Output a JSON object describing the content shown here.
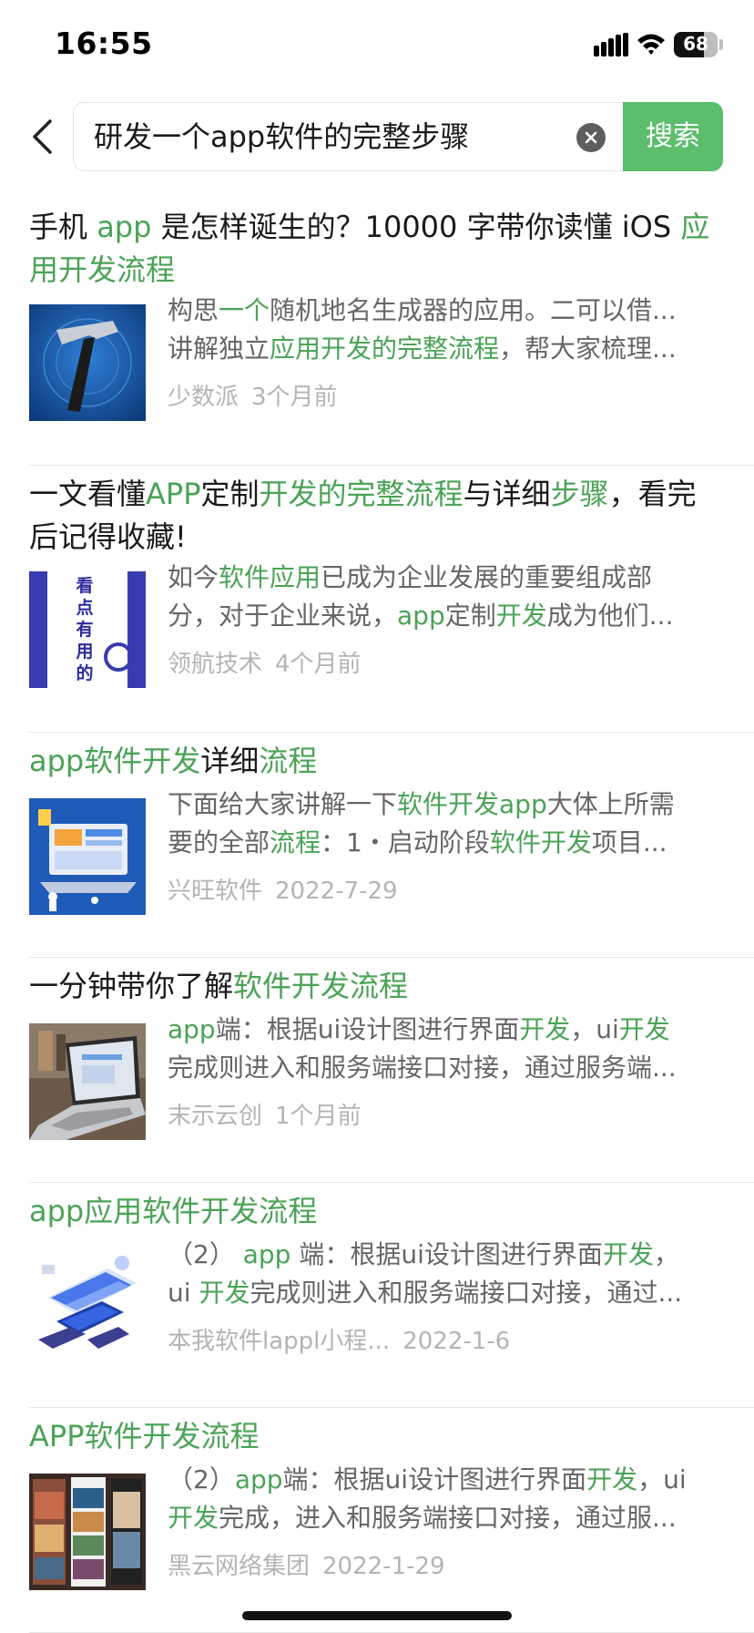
{
  "status_bar": {
    "time": "16:55",
    "battery": "68",
    "battery_level": 0.68
  },
  "search": {
    "query": "研发一个app软件的完整步骤",
    "button_label": "搜索"
  },
  "colors": {
    "accent_green": "#5cbd6c",
    "highlight_green": "#4aa356",
    "meta_gray": "#b4b4b4"
  },
  "results": [
    {
      "title": [
        {
          "t": "手机 ",
          "h": false
        },
        {
          "t": "app",
          "h": true
        },
        {
          "t": " 是怎样诞生的？10000 字带你读懂 iOS ",
          "h": false
        },
        {
          "t": "应用开发流程",
          "h": true
        }
      ],
      "snippet": [
        [
          {
            "t": "构思",
            "h": false
          },
          {
            "t": "一个",
            "h": true
          },
          {
            "t": "随机地名生成器的应用。二可以借...",
            "h": false
          }
        ],
        [
          {
            "t": "讲解独立",
            "h": false
          },
          {
            "t": "应用开发的完整流程",
            "h": true
          },
          {
            "t": "，帮大家梳理...",
            "h": false
          }
        ]
      ],
      "source": "少数派",
      "date": "3个月前",
      "thumb": "hammer-icon"
    },
    {
      "title": [
        {
          "t": "一文看懂",
          "h": false
        },
        {
          "t": "APP",
          "h": true
        },
        {
          "t": "定制",
          "h": false
        },
        {
          "t": "开发的完整流程",
          "h": true
        },
        {
          "t": "与详细",
          "h": false
        },
        {
          "t": "步骤",
          "h": true
        },
        {
          "t": "，看完后记得收藏!",
          "h": false
        }
      ],
      "snippet": [
        [
          {
            "t": "如今",
            "h": false
          },
          {
            "t": "软件应用",
            "h": true
          },
          {
            "t": "已成为企业发展的重要组成部",
            "h": false
          }
        ],
        [
          {
            "t": "分，对于企业来说，",
            "h": false
          },
          {
            "t": "app",
            "h": true
          },
          {
            "t": "定制",
            "h": false
          },
          {
            "t": "开发",
            "h": true
          },
          {
            "t": "成为他们...",
            "h": false
          }
        ]
      ],
      "source": "领航技术",
      "date": "4个月前",
      "thumb": "poster-image",
      "thumb_text": [
        "看",
        "点",
        "有",
        "用",
        "的"
      ]
    },
    {
      "title": [
        {
          "t": "app软件开发",
          "h": true
        },
        {
          "t": "详细",
          "h": false
        },
        {
          "t": "流程",
          "h": true
        }
      ],
      "snippet": [
        [
          {
            "t": "下面给大家讲解一下",
            "h": false
          },
          {
            "t": "软件开发app",
            "h": true
          },
          {
            "t": "大体上所需",
            "h": false
          }
        ],
        [
          {
            "t": "要的全部",
            "h": false
          },
          {
            "t": "流程",
            "h": true
          },
          {
            "t": "：1・启动阶段",
            "h": false
          },
          {
            "t": "软件开发",
            "h": true
          },
          {
            "t": "项目...",
            "h": false
          }
        ]
      ],
      "source": "兴旺软件",
      "date": "2022-7-29",
      "thumb": "laptop-illustration"
    },
    {
      "title": [
        {
          "t": "一分钟带你了解",
          "h": false
        },
        {
          "t": "软件开发流程",
          "h": true
        }
      ],
      "snippet": [
        [
          {
            "t": "app",
            "h": true
          },
          {
            "t": "端：根据ui设计图进行界面",
            "h": false
          },
          {
            "t": "开发",
            "h": true
          },
          {
            "t": "，ui",
            "h": false
          },
          {
            "t": "开发",
            "h": true
          }
        ],
        [
          {
            "t": "完成则进入和服务端接口对接，通过服务端...",
            "h": false
          }
        ]
      ],
      "source": "末示云创",
      "date": "1个月前",
      "thumb": "laptop-photo"
    },
    {
      "title": [
        {
          "t": "app应用软件开发流程",
          "h": true
        }
      ],
      "snippet": [
        [
          {
            "t": "（2） ",
            "h": false
          },
          {
            "t": "app",
            "h": true
          },
          {
            "t": " 端：根据ui设计图进行界面",
            "h": false
          },
          {
            "t": "开发",
            "h": true
          },
          {
            "t": "，",
            "h": false
          }
        ],
        [
          {
            "t": "ui ",
            "h": false
          },
          {
            "t": "开发",
            "h": true
          },
          {
            "t": "完成则进入和服务端接口对接，通过...",
            "h": false
          }
        ]
      ],
      "source": "本我软件lappl小程...",
      "date": "2022-1-6",
      "thumb": "isometric-illustration"
    },
    {
      "title": [
        {
          "t": "APP软件开发流程",
          "h": true
        }
      ],
      "snippet": [
        [
          {
            "t": "（2）",
            "h": false
          },
          {
            "t": "app",
            "h": true
          },
          {
            "t": "端：根据ui设计图进行界面",
            "h": false
          },
          {
            "t": "开发",
            "h": true
          },
          {
            "t": "，ui",
            "h": false
          }
        ],
        [
          {
            "t": "开发",
            "h": true
          },
          {
            "t": "完成，进入和服务端接口对接，通过服...",
            "h": false
          }
        ]
      ],
      "source": "黑云网络集团",
      "date": "2022-1-29",
      "thumb": "app-screens-image"
    }
  ]
}
